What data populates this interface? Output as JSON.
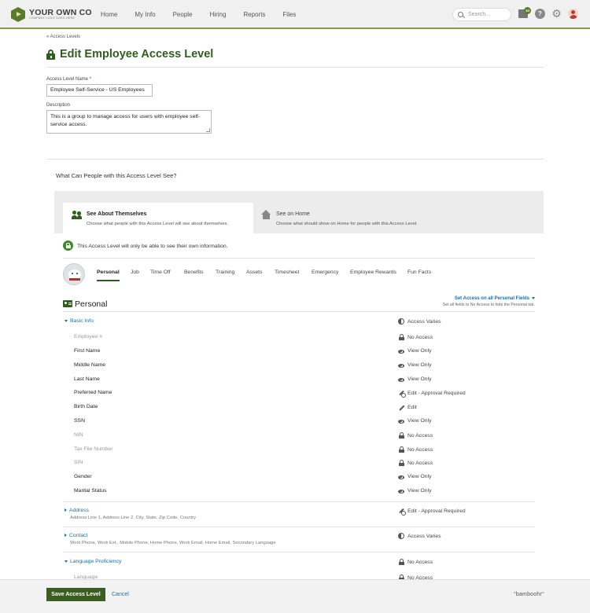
{
  "header": {
    "logo_main": "YOUR OWN CO",
    "logo_sub": "COMPANY LOGO GOES HERE",
    "nav": [
      "Home",
      "My Info",
      "People",
      "Hiring",
      "Reports",
      "Files"
    ],
    "search_placeholder": "Search...",
    "inbox_count": "14",
    "help_glyph": "?"
  },
  "breadcrumb": "« Access Levels",
  "page_title": "Edit Employee Access Level",
  "form": {
    "name_label": "Access Level Name",
    "name_required": "*",
    "name_value": "Employee Self-Service - US Employees",
    "desc_label": "Description",
    "desc_value": "This is a group to manage access for users with employee self-service access."
  },
  "section_question": "What Can People with this Access Level See?",
  "view_tabs": [
    {
      "title": "See About Themselves",
      "desc": "Choose what people with this Access Level will see about themselves."
    },
    {
      "title": "See on Home",
      "desc": "Choose what should show on Home for people with this Access Level."
    }
  ],
  "own_info_notice": "This Access Level will only be able to see their own information.",
  "employee_tabs": [
    "Personal",
    "Job",
    "Time Off",
    "Benefits",
    "Training",
    "Assets",
    "Timesheet",
    "Emergency",
    "Employee Rewards",
    "Fun Facts"
  ],
  "personal": {
    "title": "Personal",
    "set_access_label": "Set Access on all Personal Fields",
    "set_access_sub": "Set all fields to No Access to hide the Personal tab."
  },
  "groups": {
    "basic_info": {
      "label": "Basic Info",
      "access": "Access Varies"
    },
    "address": {
      "label": "Address",
      "sub": "Address Line 1, Address Line 2, City, State, Zip Code, Country",
      "access": "Edit - Approval Required"
    },
    "contact": {
      "label": "Contact",
      "sub": "Work Phone, Work Ext., Mobile Phone, Home Phone, Work Email, Home Email, Secondary Language",
      "access": "Access Varies"
    },
    "language": {
      "label": "Language Proficiency",
      "access": "No Access"
    }
  },
  "fields": [
    {
      "name": "Employee #",
      "access": "No Access",
      "icon": "lock-icon"
    },
    {
      "name": "First Name",
      "access": "View Only",
      "icon": "eye-icon"
    },
    {
      "name": "Middle Name",
      "access": "View Only",
      "icon": "eye-icon"
    },
    {
      "name": "Last Name",
      "access": "View Only",
      "icon": "eye-icon"
    },
    {
      "name": "Preferred Name",
      "access": "Edit - Approval Required",
      "icon": "pencil-approval-icon"
    },
    {
      "name": "Birth Date",
      "access": "Edit",
      "icon": "pencil-icon"
    },
    {
      "name": "SSN",
      "access": "View Only",
      "icon": "eye-icon"
    },
    {
      "name": "NIN",
      "access": "No Access",
      "icon": "lock-icon"
    },
    {
      "name": "Tax File Number",
      "access": "No Access",
      "icon": "lock-icon"
    },
    {
      "name": "SIN",
      "access": "No Access",
      "icon": "lock-icon"
    },
    {
      "name": "Gender",
      "access": "View Only",
      "icon": "eye-icon"
    },
    {
      "name": "Marital Status",
      "access": "View Only",
      "icon": "eye-icon"
    }
  ],
  "language_field": {
    "name": "Language",
    "access": "No Access"
  },
  "footer": {
    "save_label": "Save Access Level",
    "cancel_label": "Cancel",
    "brand": "°bamboohr°"
  }
}
